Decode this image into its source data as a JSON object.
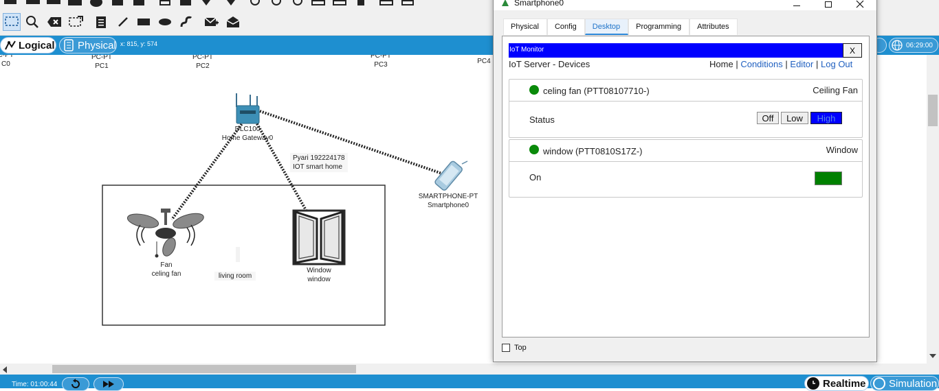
{
  "workspace": {
    "coords": "x: 815, y: 574",
    "mode_logical": "Logical",
    "mode_physical": "Physical",
    "clock": "06:29:00",
    "devices": {
      "pc0_type": "PC-PT",
      "pc0_name": "C0",
      "pc1_type": "PC-PT",
      "pc1_name": "PC1",
      "pc2_type": "PC-PT",
      "pc2_name": "PC2",
      "pc3_type": "PC-PT",
      "pc3_name": "PC3",
      "pc4_name": "PC4",
      "gateway_type": "DLC100",
      "gateway_name": "Home Gateway0",
      "note_line1": "Pyari 192224178",
      "note_line2": "IOT smart home",
      "smartphone_type": "SMARTPHONE-PT",
      "smartphone_name": "Smartphone0",
      "fan_type": "Fan",
      "fan_name": "celing fan",
      "window_type": "Window",
      "window_name": "window",
      "room_label": "living room"
    }
  },
  "status": {
    "time": "Time: 01:00:44",
    "realtime": "Realtime",
    "simulation": "Simulation"
  },
  "dialog": {
    "title": "Smartphone0",
    "tabs": [
      "Physical",
      "Config",
      "Desktop",
      "Programming",
      "Attributes"
    ],
    "active_tab": "Desktop",
    "iot": {
      "window_title": "IoT Monitor",
      "close": "X",
      "subtitle": "IoT Server - Devices",
      "nav": [
        "Home",
        "Conditions",
        "Editor",
        "Log Out"
      ],
      "nav_sep": "|",
      "devices": [
        {
          "name": "celing fan (PTT08107710-)",
          "type": "Ceiling Fan",
          "status_dot_color": "#0a8a0a",
          "property": "Status",
          "options": [
            "Off",
            "Low",
            "High"
          ],
          "selected": "High"
        },
        {
          "name": "window (PTT0810S17Z-)",
          "type": "Window",
          "status_dot_color": "#0a8a0a",
          "property": "On",
          "toggle_color": "#008000"
        }
      ]
    },
    "top_checkbox": "Top"
  },
  "colors": {
    "accent_blue": "#1e8fd0",
    "iot_title_bar": "#0000ff",
    "selected_option": "#0000ff",
    "status_green": "#0a8a0a"
  }
}
